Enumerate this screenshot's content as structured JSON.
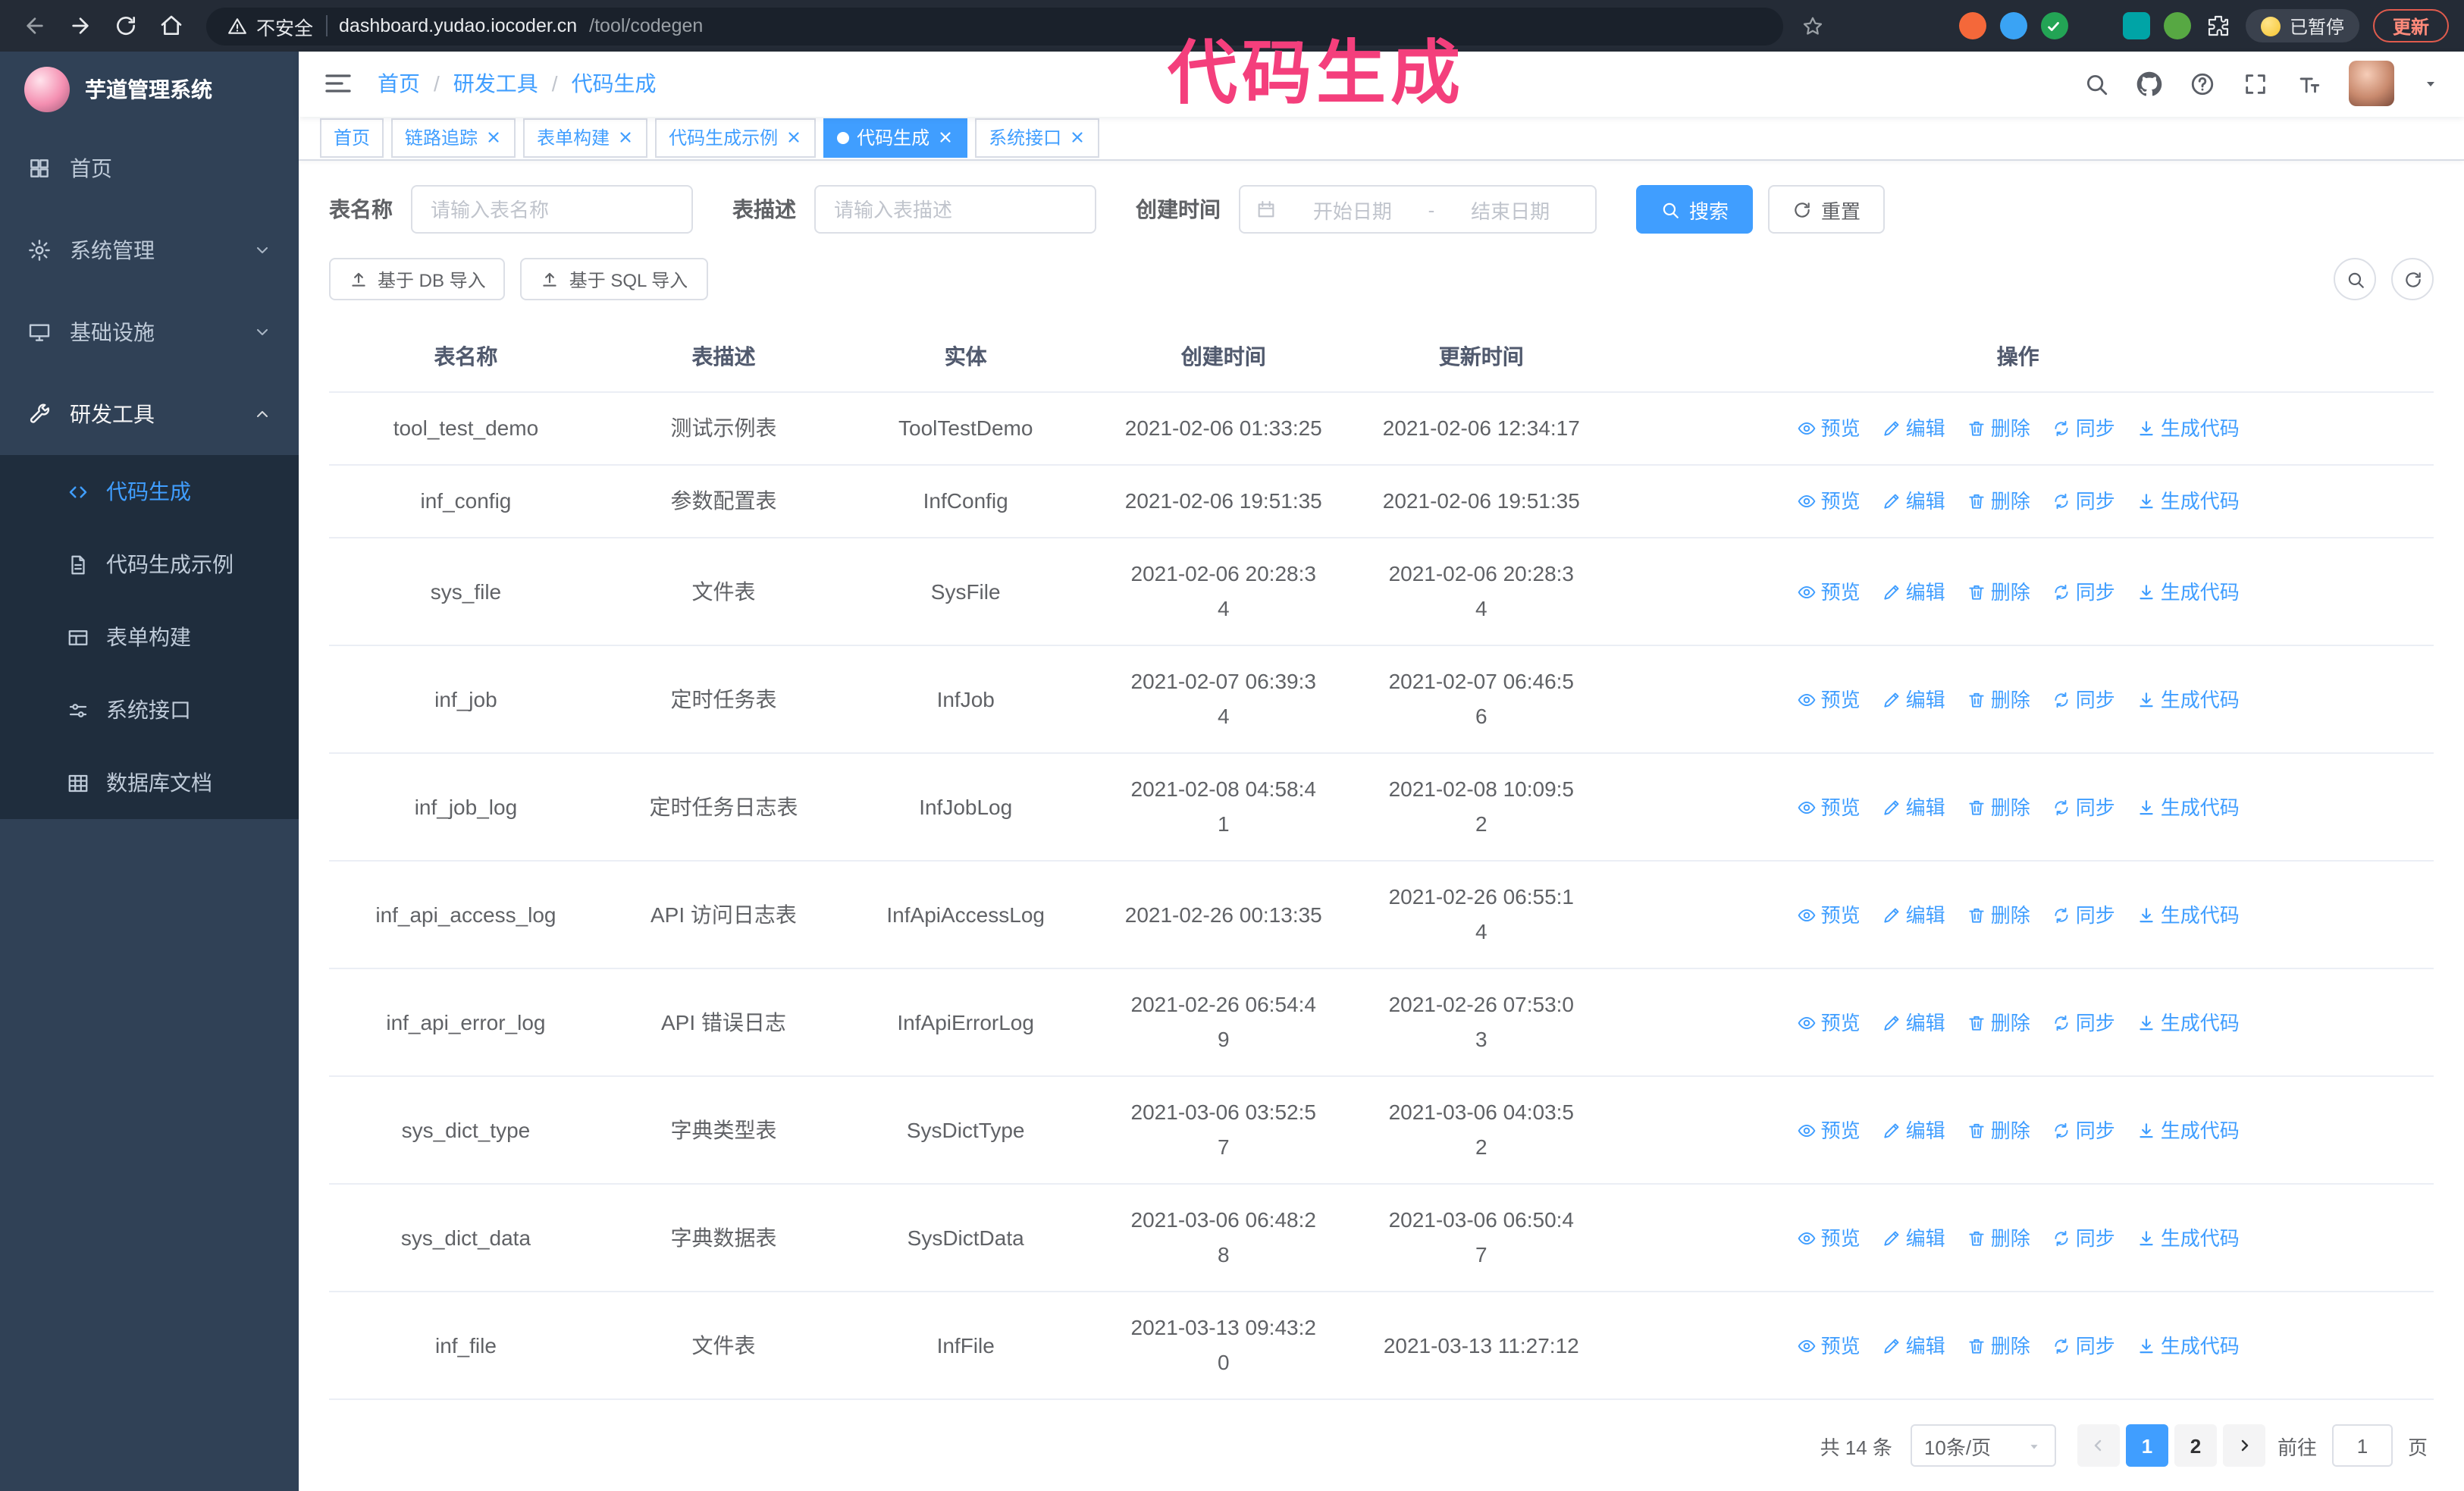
{
  "colors": {
    "primary": "#409eff",
    "sidebar_bg": "#304156",
    "submenu_bg": "#1f2d3d",
    "annotation": "#f43f7c",
    "chrome_bg": "#242b36"
  },
  "browser": {
    "security_label": "不安全",
    "url_host": "dashboard.yudao.iocoder.cn",
    "url_path": "/tool/codegen",
    "paused_badge": "已暂停",
    "update_button": "更新"
  },
  "annotation": {
    "text": "代码生成"
  },
  "sidebar": {
    "logo_title": "芋道管理系统",
    "items": [
      {
        "label": "首页"
      },
      {
        "label": "系统管理"
      },
      {
        "label": "基础设施"
      },
      {
        "label": "研发工具"
      }
    ],
    "submenu": [
      {
        "label": "代码生成"
      },
      {
        "label": "代码生成示例"
      },
      {
        "label": "表单构建"
      },
      {
        "label": "系统接口"
      },
      {
        "label": "数据库文档"
      }
    ]
  },
  "header": {
    "breadcrumb": [
      "首页",
      "研发工具",
      "代码生成"
    ]
  },
  "tabs": [
    {
      "label": "首页"
    },
    {
      "label": "链路追踪"
    },
    {
      "label": "表单构建"
    },
    {
      "label": "代码生成示例"
    },
    {
      "label": "代码生成"
    },
    {
      "label": "系统接口"
    }
  ],
  "filters": {
    "table_name_label": "表名称",
    "table_name_placeholder": "请输入表名称",
    "table_desc_label": "表描述",
    "table_desc_placeholder": "请输入表描述",
    "create_time_label": "创建时间",
    "date_start_placeholder": "开始日期",
    "date_separator": "-",
    "date_end_placeholder": "结束日期",
    "search_label": "搜索",
    "reset_label": "重置"
  },
  "toolbar": {
    "import_db": "基于 DB 导入",
    "import_sql": "基于 SQL 导入"
  },
  "table": {
    "columns": [
      "表名称",
      "表描述",
      "实体",
      "创建时间",
      "更新时间",
      "操作"
    ],
    "row_actions": [
      "预览",
      "编辑",
      "删除",
      "同步",
      "生成代码"
    ],
    "rows": [
      {
        "name": "tool_test_demo",
        "desc": "测试示例表",
        "entity": "ToolTestDemo",
        "created": "2021-02-06 01:33:25",
        "updated": "2021-02-06 12:34:17"
      },
      {
        "name": "inf_config",
        "desc": "参数配置表",
        "entity": "InfConfig",
        "created": "2021-02-06 19:51:35",
        "updated": "2021-02-06 19:51:35"
      },
      {
        "name": "sys_file",
        "desc": "文件表",
        "entity": "SysFile",
        "created": "2021-02-06 20:28:3\n4",
        "updated": "2021-02-06 20:28:3\n4"
      },
      {
        "name": "inf_job",
        "desc": "定时任务表",
        "entity": "InfJob",
        "created": "2021-02-07 06:39:3\n4",
        "updated": "2021-02-07 06:46:5\n6"
      },
      {
        "name": "inf_job_log",
        "desc": "定时任务日志表",
        "entity": "InfJobLog",
        "created": "2021-02-08 04:58:4\n1",
        "updated": "2021-02-08 10:09:5\n2"
      },
      {
        "name": "inf_api_access_log",
        "desc": "API 访问日志表",
        "entity": "InfApiAccessLog",
        "created": "2021-02-26 00:13:35",
        "updated": "2021-02-26 06:55:1\n4"
      },
      {
        "name": "inf_api_error_log",
        "desc": "API 错误日志",
        "entity": "InfApiErrorLog",
        "created": "2021-02-26 06:54:4\n9",
        "updated": "2021-02-26 07:53:0\n3"
      },
      {
        "name": "sys_dict_type",
        "desc": "字典类型表",
        "entity": "SysDictType",
        "created": "2021-03-06 03:52:5\n7",
        "updated": "2021-03-06 04:03:5\n2"
      },
      {
        "name": "sys_dict_data",
        "desc": "字典数据表",
        "entity": "SysDictData",
        "created": "2021-03-06 06:48:2\n8",
        "updated": "2021-03-06 06:50:4\n7"
      },
      {
        "name": "inf_file",
        "desc": "文件表",
        "entity": "InfFile",
        "created": "2021-03-13 09:43:2\n0",
        "updated": "2021-03-13 11:27:12"
      }
    ]
  },
  "pagination": {
    "total": "共 14 条",
    "page_size": "10条/页",
    "pages": [
      "1",
      "2"
    ],
    "active_page": "1",
    "goto_prefix": "前往",
    "goto_value": "1",
    "goto_suffix": "页"
  },
  "icons": [
    "back-icon",
    "forward-icon",
    "reload-icon",
    "home-icon",
    "warning-icon",
    "bookmark-star-icon",
    "extension-icon",
    "puzzle-icon",
    "hamburger-icon",
    "search-icon",
    "github-icon",
    "help-icon",
    "fullscreen-icon",
    "font-size-icon",
    "caret-down-icon",
    "dashboard-icon",
    "gear-icon",
    "monitor-icon",
    "tool-icon",
    "code-icon",
    "document-icon",
    "form-icon",
    "sliders-icon",
    "database-icon",
    "calendar-icon",
    "refresh-icon",
    "upload-icon",
    "eye-icon",
    "edit-icon",
    "trash-icon",
    "sync-icon",
    "download-icon",
    "close-icon",
    "chevron-down-icon",
    "chevron-up-icon"
  ]
}
